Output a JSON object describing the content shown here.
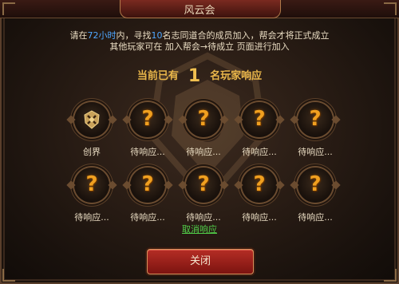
{
  "window": {
    "title": "风云会"
  },
  "info": {
    "line1": {
      "prefix": "请在",
      "hours": "72小时",
      "middle": "内，寻找",
      "count": "10",
      "suffix": "名志同道合的成员加入，帮会才将正式成立"
    },
    "line2": "其他玩家可在 加入帮会→待成立 页面进行加入"
  },
  "respond": {
    "prefix": "当前已有",
    "count": "1",
    "suffix": "名玩家响应"
  },
  "slots": [
    {
      "label": "创界",
      "icon": "guild-crest-icon"
    },
    {
      "label": "待响应...",
      "icon": "question-mark-icon"
    },
    {
      "label": "待响应...",
      "icon": "question-mark-icon"
    },
    {
      "label": "待响应...",
      "icon": "question-mark-icon"
    },
    {
      "label": "待响应...",
      "icon": "question-mark-icon"
    },
    {
      "label": "待响应...",
      "icon": "question-mark-icon"
    },
    {
      "label": "待响应...",
      "icon": "question-mark-icon"
    },
    {
      "label": "待响应...",
      "icon": "question-mark-icon"
    },
    {
      "label": "待响应...",
      "icon": "question-mark-icon"
    },
    {
      "label": "待响应...",
      "icon": "question-mark-icon"
    }
  ],
  "qmark": "?",
  "actions": {
    "cancel": "取消响应",
    "close": "关闭"
  },
  "colors": {
    "highlight": "#4fa7ff",
    "gold": "#e9b64a",
    "link": "#52d24a",
    "button": "#9c1f18"
  }
}
